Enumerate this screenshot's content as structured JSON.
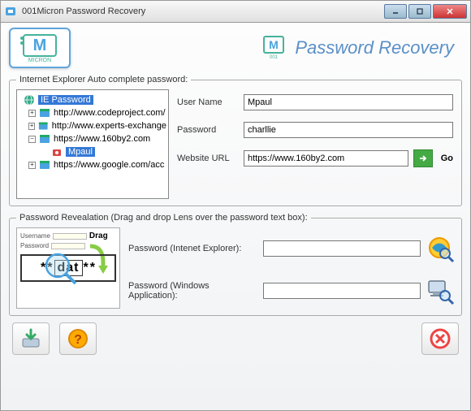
{
  "window": {
    "title": "001Micron Password Recovery"
  },
  "brand": {
    "title": "Password Recovery"
  },
  "section1": {
    "legend": "Internet Explorer Auto complete password:",
    "tree": {
      "root": "IE Password",
      "items": [
        {
          "expanded": false,
          "label": "http://www.codeproject.com/"
        },
        {
          "expanded": false,
          "label": "http://www.experts-exchange"
        },
        {
          "expanded": true,
          "label": "https://www.160by2.com",
          "child": "Mpaul"
        },
        {
          "expanded": false,
          "label": "https://www.google.com/acc"
        }
      ]
    },
    "form": {
      "username_label": "User Name",
      "username_value": "Mpaul",
      "password_label": "Password",
      "password_value": "charllie",
      "url_label": "Website URL",
      "url_value": "https://www.160by2.com",
      "go_label": "Go"
    }
  },
  "section2": {
    "legend": "Password Revealation (Drag and drop Lens over the password text box):",
    "preview": {
      "username": "Username",
      "password": "Password",
      "drag": "Drag",
      "revealed": "dat"
    },
    "ie_label": "Password (Intenet Explorer):",
    "win_label": "Password (Windows Application):"
  }
}
